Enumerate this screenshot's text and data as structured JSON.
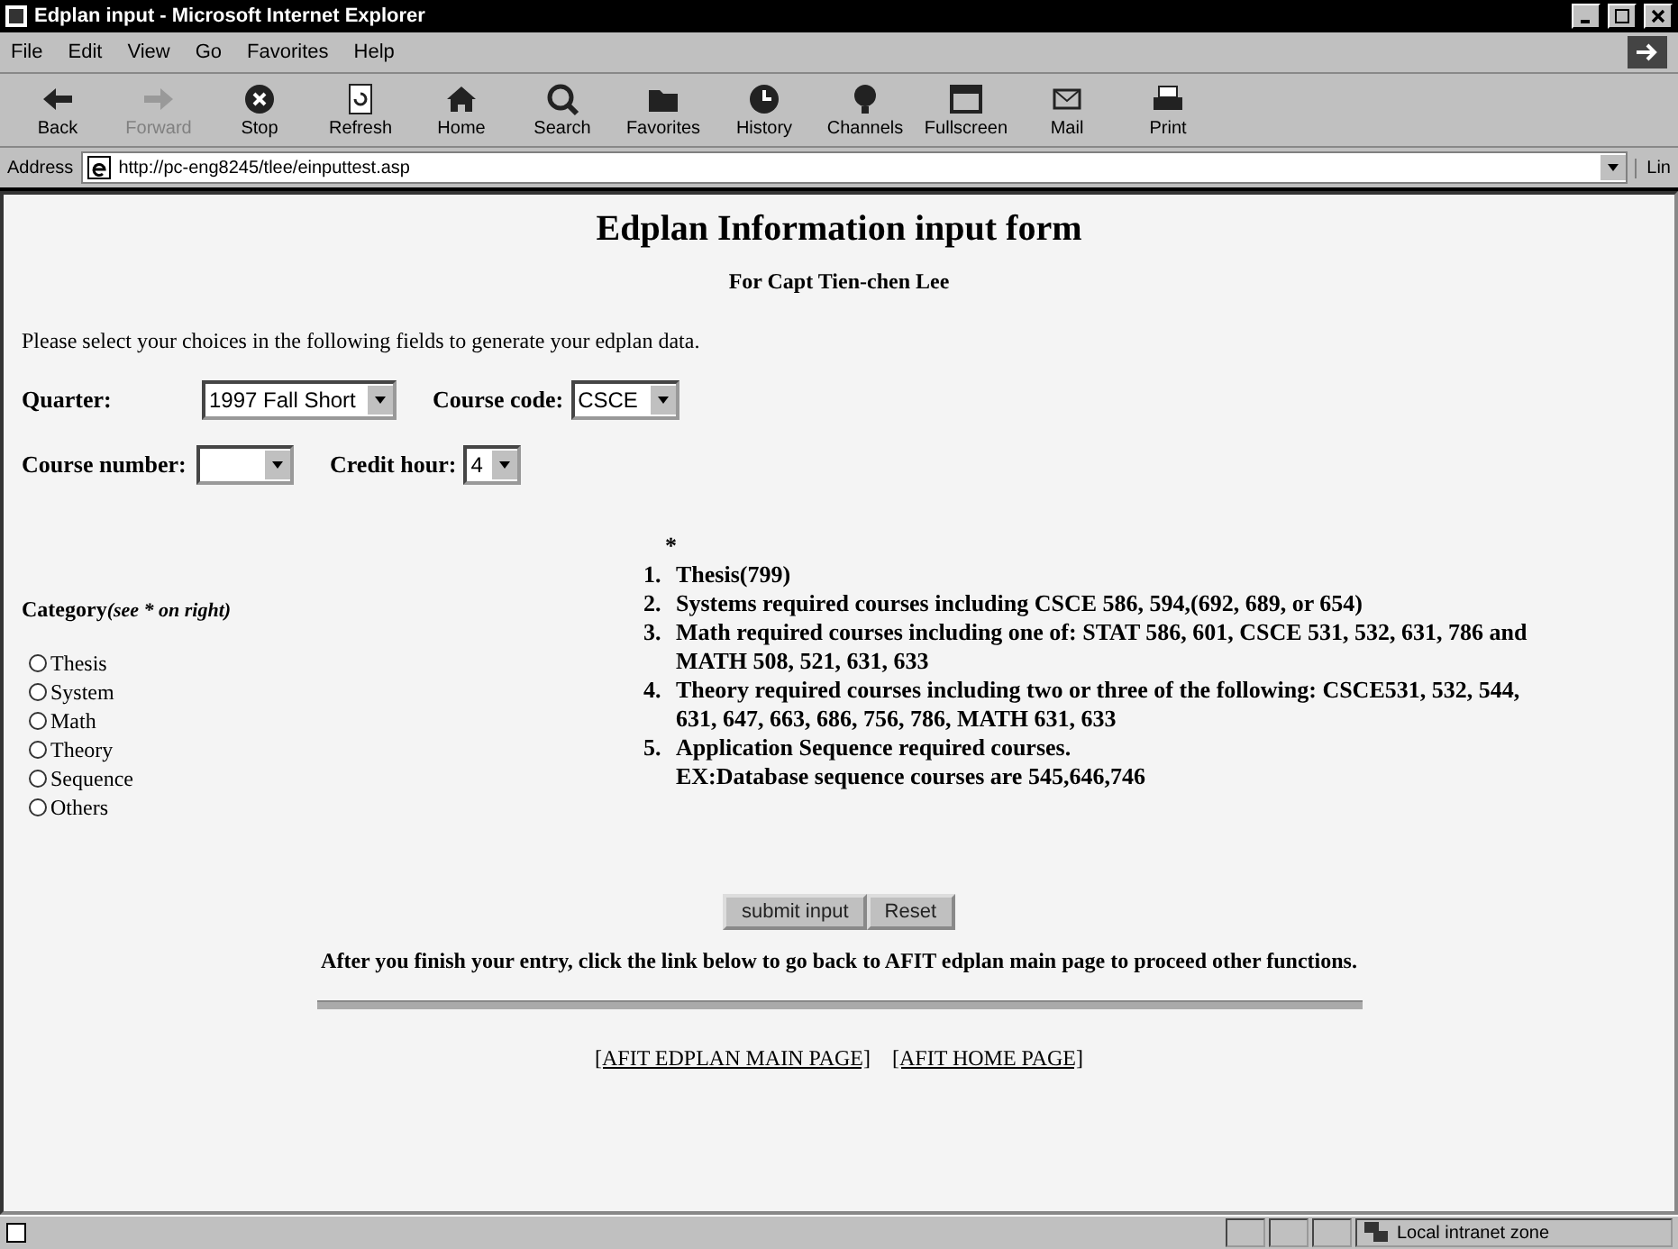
{
  "window": {
    "title": "Edplan input - Microsoft Internet Explorer"
  },
  "menu": [
    "File",
    "Edit",
    "View",
    "Go",
    "Favorites",
    "Help"
  ],
  "toolbar": [
    {
      "label": "Back",
      "disabled": false
    },
    {
      "label": "Forward",
      "disabled": true
    },
    {
      "label": "Stop",
      "disabled": false
    },
    {
      "label": "Refresh",
      "disabled": false
    },
    {
      "label": "Home",
      "disabled": false
    },
    {
      "label": "Search",
      "disabled": false
    },
    {
      "label": "Favorites",
      "disabled": false
    },
    {
      "label": "History",
      "disabled": false
    },
    {
      "label": "Channels",
      "disabled": false
    },
    {
      "label": "Fullscreen",
      "disabled": false
    },
    {
      "label": "Mail",
      "disabled": false
    },
    {
      "label": "Print",
      "disabled": false
    }
  ],
  "address": {
    "label": "Address",
    "value": "http://pc-eng8245/tlee/einputtest.asp",
    "links": "Lin"
  },
  "page": {
    "heading": "Edplan Information input form",
    "subheading": "For Capt  Tien-chen Lee",
    "intro": "Please select your choices in the following fields to generate your edplan data.",
    "fields": [
      [
        {
          "label": "Quarter:",
          "value": "1997 Fall Short"
        },
        {
          "label": "Course code:",
          "value": "CSCE"
        }
      ],
      [
        {
          "label": "Course number:"
        },
        {
          "label": "Credit hour:",
          "value": "4"
        }
      ]
    ],
    "category": {
      "label": "Category",
      "note": "(see * on right)",
      "options": [
        {
          "label": "Thesis",
          "selected": false
        },
        {
          "label": "System",
          "selected": false
        },
        {
          "label": "Math",
          "selected": false
        },
        {
          "label": "Theory",
          "selected": false
        },
        {
          "label": "Sequence",
          "selected": false
        },
        {
          "label": "Others",
          "selected": false
        }
      ]
    },
    "notes": {
      "marker": "*",
      "items": [
        {
          "number": "1.",
          "text": "Thesis(799)"
        },
        {
          "number": "2.",
          "text": "Systems required courses including CSCE 586, 594,(692, 689, or 654)"
        },
        {
          "number": "3.",
          "text": "Math required courses including one of: STAT 586, 601, CSCE 531, 532, 631, 786 and MATH 508, 521, 631, 633"
        },
        {
          "number": "4.",
          "text": "Theory required courses including two or three of the following: CSCE531, 532, 544, 631, 647, 663, 686, 756, 786, MATH 631, 633"
        },
        {
          "number": "5.",
          "text": "Application Sequence required courses.",
          "extra": "EX:Database sequence courses are 545,646,746"
        }
      ]
    },
    "buttons": [
      "submit input",
      "Reset"
    ],
    "footer": "After you finish your entry, click the link below to go back to AFIT edplan main page to proceed other functions.",
    "links": [
      "[AFIT EDPLAN MAIN PAGE]",
      "[AFIT HOME PAGE]"
    ]
  },
  "status_bar": {
    "zone": "Local intranet zone"
  }
}
